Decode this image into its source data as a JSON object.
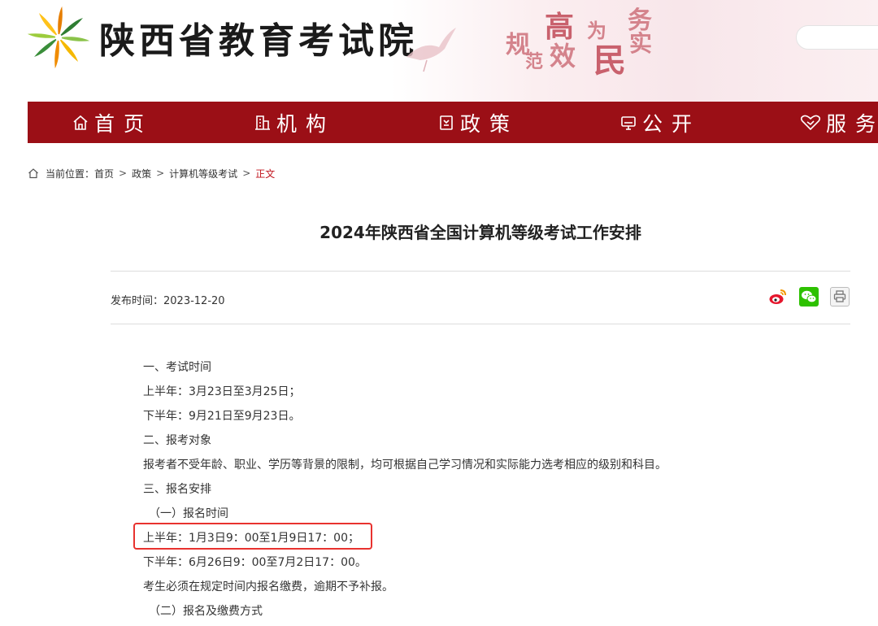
{
  "site": {
    "name": "陕西省教育考试院",
    "slogan_chars": [
      "规",
      "范",
      "高",
      "效",
      "为",
      "民",
      "务",
      "实"
    ],
    "search_placeholder": ""
  },
  "nav": [
    {
      "label": "首页",
      "icon": "home-icon"
    },
    {
      "label": "机构",
      "icon": "building-icon"
    },
    {
      "label": "政策",
      "icon": "document-icon"
    },
    {
      "label": "公开",
      "icon": "monitor-icon"
    },
    {
      "label": "服务",
      "icon": "handshake-heart-icon"
    }
  ],
  "breadcrumb": {
    "prefix": "当前位置：",
    "items": [
      "首页",
      "政策",
      "计算机等级考试"
    ],
    "current": "正文",
    "separator": ">"
  },
  "article": {
    "title": "2024年陕西省全国计算机等级考试工作安排",
    "publish_label": "发布时间：",
    "publish_date": "2023-12-20",
    "share": [
      {
        "name": "weibo-share-icon",
        "color": "#e6162d"
      },
      {
        "name": "wechat-share-icon",
        "color": "#2dc100"
      },
      {
        "name": "print-icon",
        "color": "#888888"
      }
    ],
    "paragraphs": [
      "一、考试时间",
      "上半年：3月23日至3月25日；",
      "下半年：9月21日至9月23日。",
      "二、报考对象",
      "报考者不受年龄、职业、学历等背景的限制，均可根据自己学习情况和实际能力选考相应的级别和科目。",
      "三、报名安排",
      "（一）报名时间",
      "上半年：1月3日9：00至1月9日17：00；",
      "下半年：6月26日9：00至7月2日17：00。",
      "考生必须在规定时间内报名缴费，逾期不予补报。",
      "（二）报名及缴费方式"
    ]
  },
  "colors": {
    "nav_bg": "#9b0f16",
    "current_crumb": "#c0121b",
    "highlight": "#e8322f"
  }
}
